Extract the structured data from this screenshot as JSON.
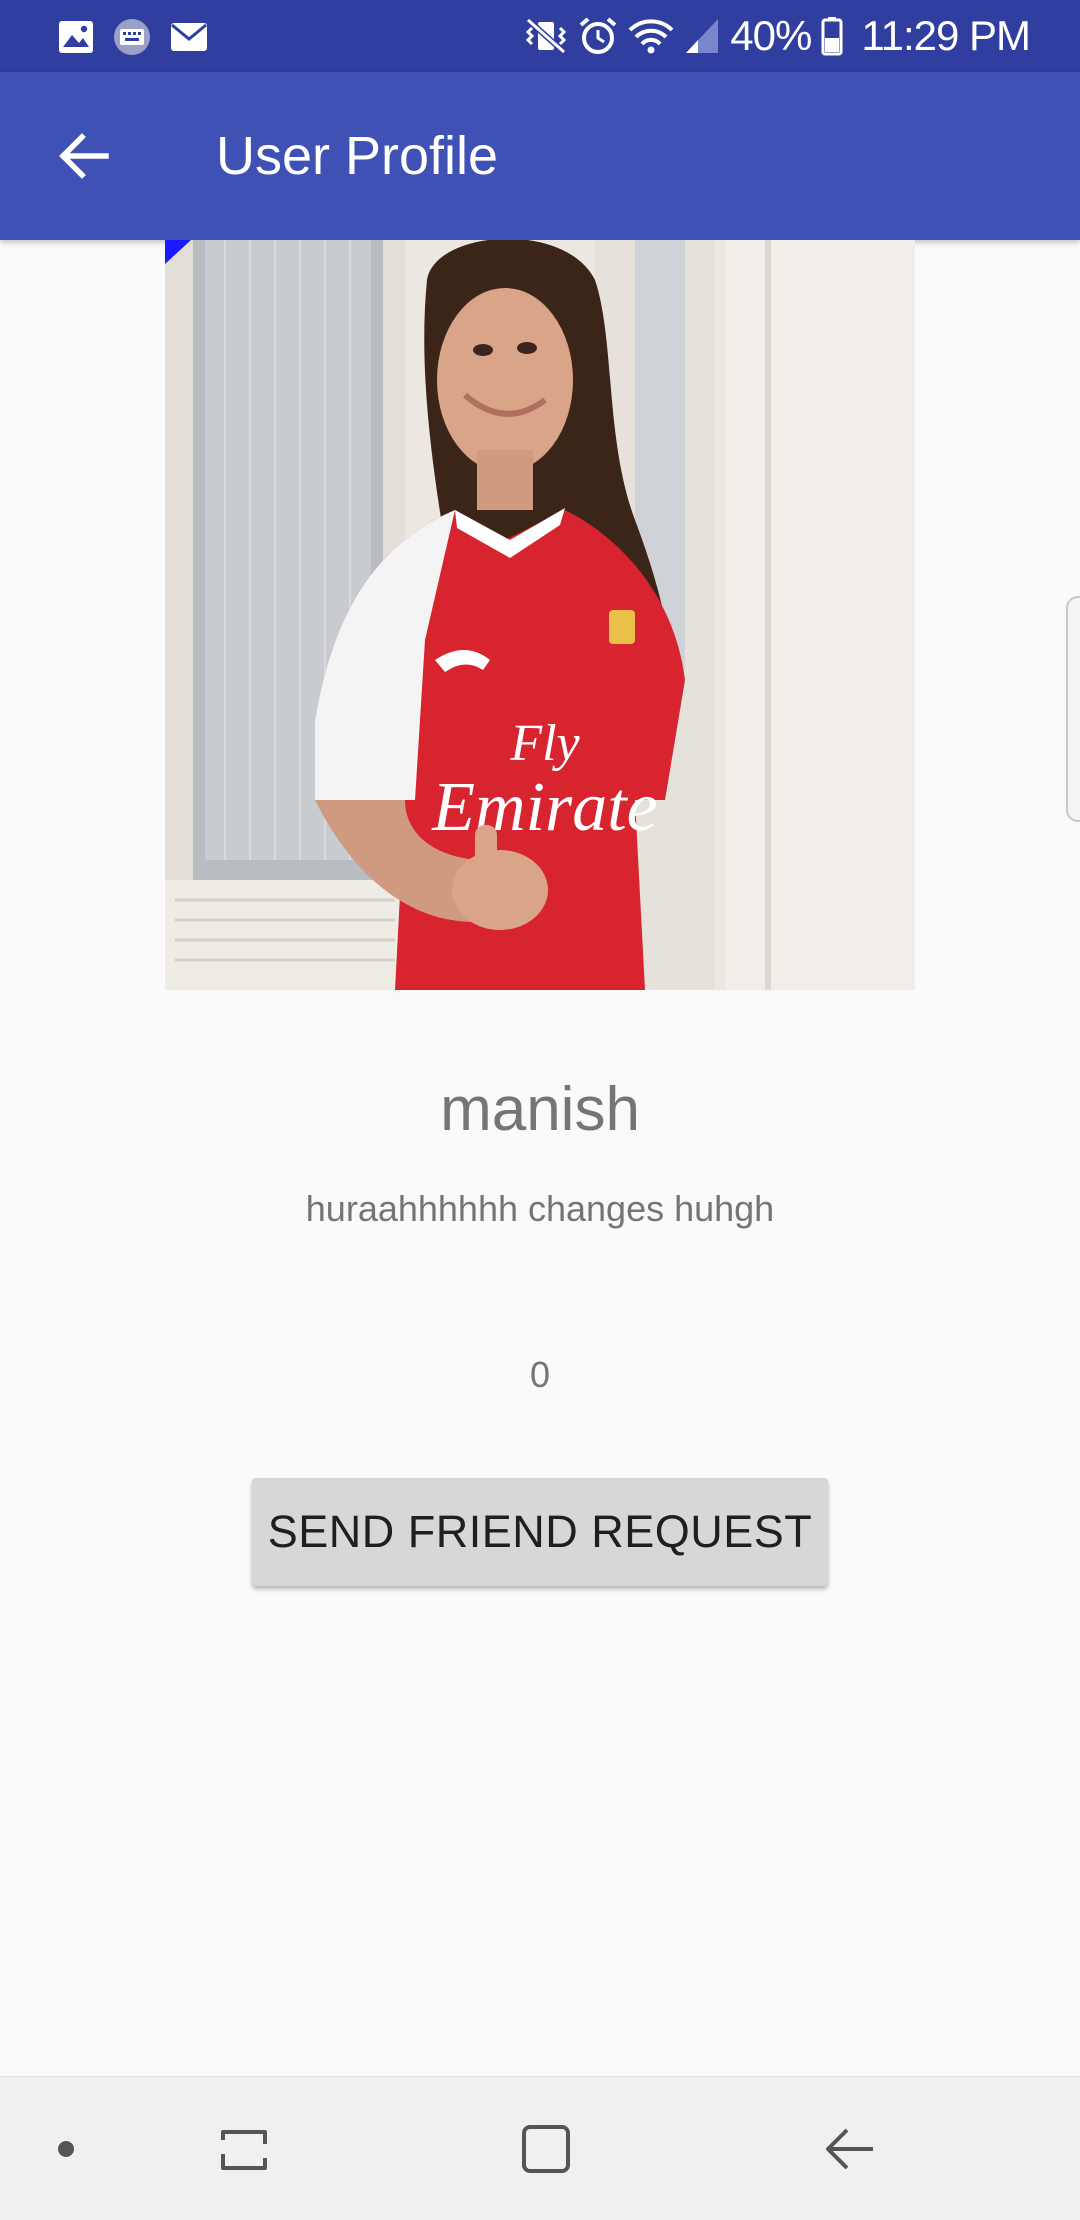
{
  "status_bar": {
    "left_icons": [
      "gallery-icon",
      "keyboard-icon",
      "email-icon"
    ],
    "right_icons": [
      "vibrate-mute-icon",
      "alarm-icon",
      "wifi-icon",
      "signal-icon",
      "battery-icon"
    ],
    "battery": "40%",
    "time": "11:29 PM"
  },
  "app_bar": {
    "title": "User Profile",
    "back_icon": "arrow-back-icon",
    "background": "#3f51b5"
  },
  "profile": {
    "display_name": "manish",
    "status": "huraahhhhhh changes huhgh",
    "friends_count": "0",
    "image_caption_lines": [
      "Fly",
      "Emirate"
    ]
  },
  "actions": {
    "send_request_label": "SEND FRIEND REQUEST"
  },
  "nav_bar": {
    "items": [
      "dot-icon",
      "recent-apps-icon",
      "home-icon",
      "back-icon"
    ]
  },
  "colors": {
    "status_bar": "#303f9f",
    "app_bar": "#3f51b5",
    "text_secondary": "#757575",
    "button": "#d6d7d7"
  }
}
